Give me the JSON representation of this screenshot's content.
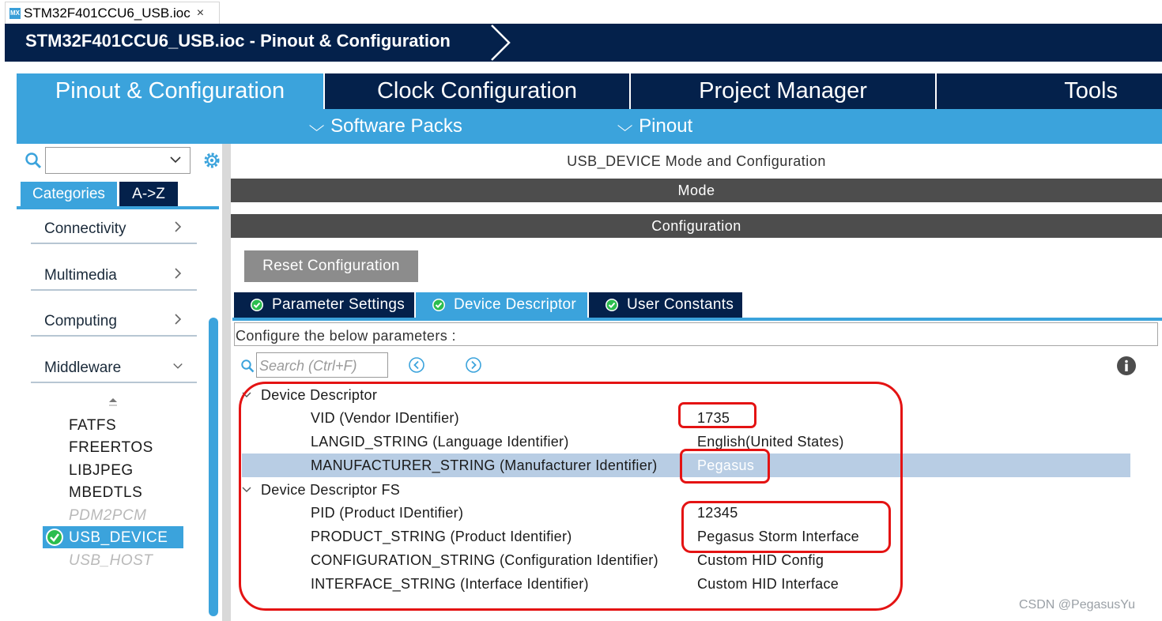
{
  "file_tab": {
    "icon_text": "MX",
    "label": "STM32F401CCU6_USB.ioc",
    "close": "×"
  },
  "breadcrumb": {
    "title": "STM32F401CCU6_USB.ioc - Pinout & Configuration"
  },
  "main_tabs": [
    {
      "label": "Pinout & Configuration",
      "active": true
    },
    {
      "label": "Clock Configuration",
      "active": false
    },
    {
      "label": "Project Manager",
      "active": false
    },
    {
      "label": "Tools",
      "active": false
    }
  ],
  "sub_bar": {
    "software_packs": "Software Packs",
    "pinout": "Pinout"
  },
  "left_panel": {
    "tabs": {
      "categories": "Categories",
      "az": "A->Z"
    },
    "categories": [
      "Connectivity",
      "Multimedia",
      "Computing",
      "Middleware"
    ],
    "middleware_items": [
      {
        "label": "FATFS",
        "enabled": true
      },
      {
        "label": "FREERTOS",
        "enabled": true
      },
      {
        "label": "LIBJPEG",
        "enabled": true
      },
      {
        "label": "MBEDTLS",
        "enabled": true
      },
      {
        "label": "PDM2PCM",
        "enabled": false
      },
      {
        "label": "USB_DEVICE",
        "enabled": true,
        "selected": true
      },
      {
        "label": "USB_HOST",
        "enabled": false
      }
    ]
  },
  "right_panel": {
    "title": "USB_DEVICE Mode and Configuration",
    "mode_label": "Mode",
    "configuration_label": "Configuration",
    "reset_button": "Reset Configuration",
    "config_tabs": [
      {
        "label": "Parameter Settings",
        "active": false
      },
      {
        "label": "Device Descriptor",
        "active": true
      },
      {
        "label": "User Constants",
        "active": false
      }
    ],
    "configure_text": "Configure the below parameters :",
    "search_placeholder": "Search (Ctrl+F)",
    "groups": [
      {
        "name": "Device Descriptor",
        "params": [
          {
            "name": "VID (Vendor IDentifier)",
            "value": "1735"
          },
          {
            "name": "LANGID_STRING (Language Identifier)",
            "value": "English(United States)"
          },
          {
            "name": "MANUFACTURER_STRING (Manufacturer Identifier)",
            "value": "Pegasus",
            "selected": true
          }
        ]
      },
      {
        "name": "Device Descriptor FS",
        "params": [
          {
            "name": "PID (Product IDentifier)",
            "value": "12345"
          },
          {
            "name": "PRODUCT_STRING (Product Identifier)",
            "value": "Pegasus Storm Interface"
          },
          {
            "name": "CONFIGURATION_STRING (Configuration Identifier)",
            "value": "Custom HID Config"
          },
          {
            "name": "INTERFACE_STRING (Interface Identifier)",
            "value": "Custom HID Interface"
          }
        ]
      }
    ]
  },
  "watermark": "CSDN @PegasusYu",
  "colors": {
    "navy": "#04214b",
    "accent_blue": "#3ba3dc",
    "dark_gray_bar": "#4d4d4d",
    "selection": "#b8cde4",
    "annotation_red": "#e41313",
    "check_green": "#2bbd4e"
  }
}
